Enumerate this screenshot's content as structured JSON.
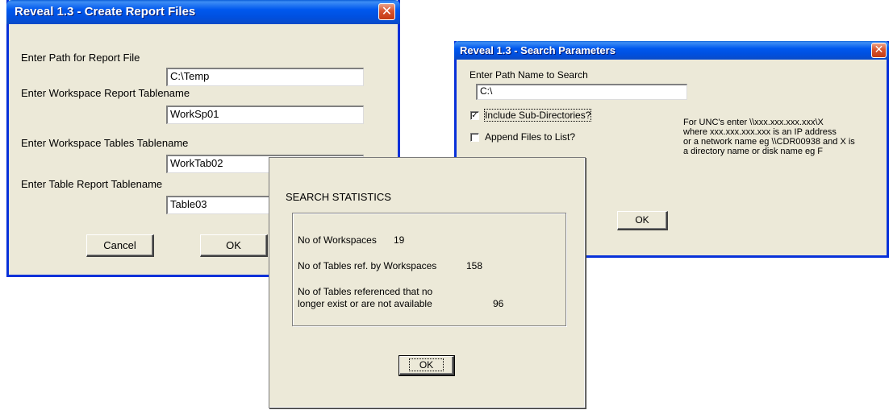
{
  "create_report": {
    "title": "Reveal 1.3 - Create Report Files",
    "close_glyph": "✕",
    "path_label": "Enter Path for Report File",
    "path_value": "C:\\Temp",
    "ws_report_label": "Enter Workspace Report Tablename",
    "ws_report_value": "WorkSp01",
    "ws_tables_label": "Enter Workspace Tables Tablename",
    "ws_tables_value": "WorkTab02",
    "table_report_label": "Enter Table Report Tablename",
    "table_report_value": "Table03",
    "cancel_label": "Cancel",
    "ok_label": "OK"
  },
  "search_params": {
    "title": "Reveal 1.3 - Search Parameters",
    "close_glyph": "✕",
    "path_label": "Enter Path Name to Search",
    "path_value": "C:\\",
    "include_subdirs_label": "Include Sub-Directories?",
    "include_subdirs_checked": true,
    "append_files_label": "Append Files to List?",
    "append_files_checked": false,
    "check_glyph": "✓",
    "unc_help": [
      "For UNC's enter \\\\xxx.xxx.xxx.xxx\\X",
      "where xxx.xxx.xxx.xxx is an IP address",
      "or a network name eg \\\\CDR00938 and X is",
      "a directory name or disk name eg F"
    ],
    "ok_label": "OK"
  },
  "search_stats": {
    "heading": "SEARCH STATISTICS",
    "workspaces_label": "No of Workspaces",
    "workspaces_value": "19",
    "tables_label": "No of Tables ref. by Workspaces",
    "tables_value": "158",
    "missing_label_line1": "No of Tables referenced that no",
    "missing_label_line2": "longer exist or are not available",
    "missing_value": "96",
    "ok_label": "OK"
  }
}
